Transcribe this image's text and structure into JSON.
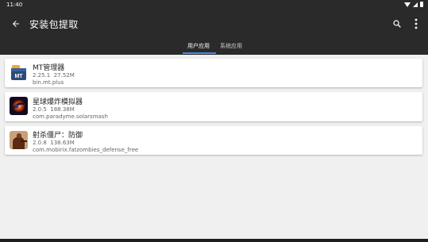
{
  "status": {
    "time": "11:40"
  },
  "appbar": {
    "title": "安装包提取",
    "back_icon": "arrow-back-icon",
    "search_icon": "search-icon",
    "menu_icon": "more-vert-icon"
  },
  "tabs": [
    {
      "label": "用户应用",
      "selected": true
    },
    {
      "label": "系统应用",
      "selected": false
    }
  ],
  "colors": {
    "bar": "#2a2a2a",
    "accent": "#4a8ae8",
    "content_bg": "#f0f0f0",
    "card": "#ffffff"
  },
  "apps": [
    {
      "name": "MT管理器",
      "version": "2.25.1",
      "size": "27.52M",
      "package": "bin.mt.plus",
      "icon": "mt-manager-icon"
    },
    {
      "name": "星球爆炸模拟器",
      "version": "2.0.5",
      "size": "188.38M",
      "package": "com.paradyme.solarsmash",
      "icon": "solar-smash-icon"
    },
    {
      "name": "射杀僵尸：防御",
      "version": "2.0.8",
      "size": "138.63M",
      "package": "com.mobirix.fatzombies_defense_free",
      "icon": "zombie-defense-icon"
    }
  ]
}
